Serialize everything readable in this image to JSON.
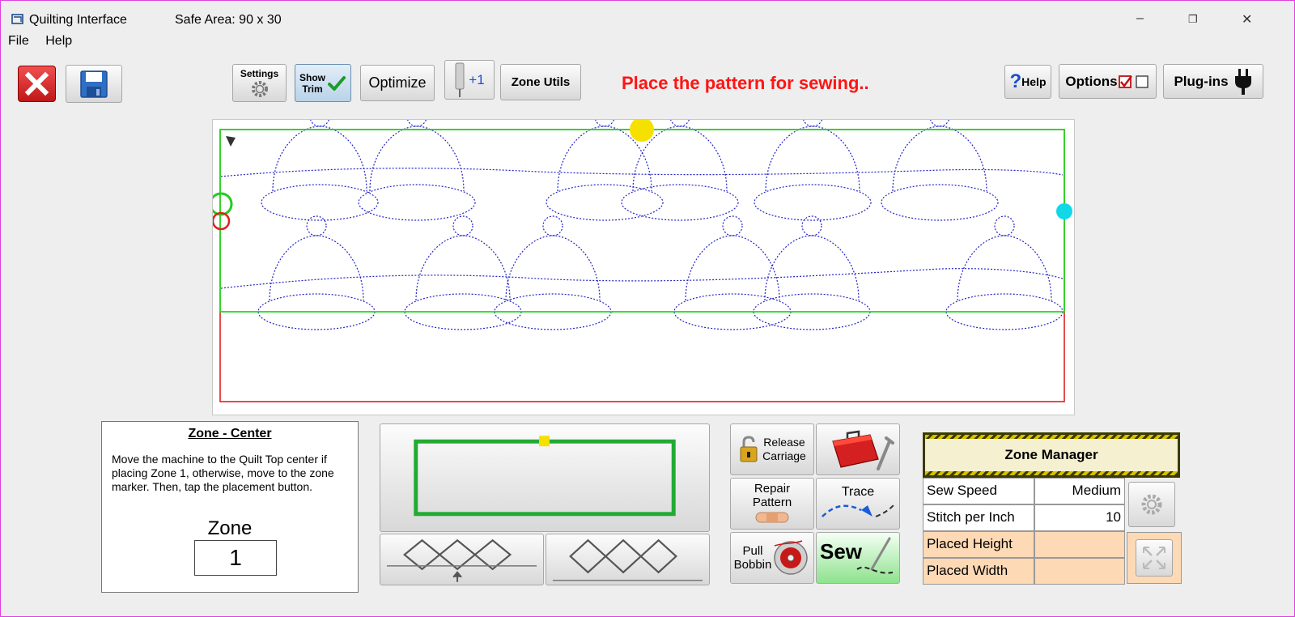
{
  "window": {
    "title": "Quilting Interface",
    "safe_area": "Safe Area:  90 x 30",
    "minimize": "–",
    "restore": "❐",
    "close": "✕"
  },
  "menu": {
    "file": "File",
    "help": "Help"
  },
  "toolbar": {
    "settings_label": "Settings",
    "show_trim_label_1": "Show",
    "show_trim_label_2": "Trim",
    "optimize_label": "Optimize",
    "needle_plus_label": "+1",
    "zone_utils_label": "Zone Utils",
    "status_message": "Place the pattern for sewing..",
    "help_label": "Help",
    "help_mark": "?",
    "options_label": "Options",
    "plugins_label": "Plug-ins"
  },
  "info_panel": {
    "title": "Zone - Center",
    "text": "Move the machine to the Quilt Top center if placing Zone 1, otherwise, move to the zone marker. Then, tap the placement button.",
    "zone_label": "Zone",
    "zone_value": "1"
  },
  "tools": {
    "release_carriage_1": "Release",
    "release_carriage_2": "Carriage",
    "repair_pattern_1": "Repair",
    "repair_pattern_2": "Pattern",
    "trace": "Trace",
    "pull_bobbin_1": "Pull",
    "pull_bobbin_2": "Bobbin",
    "sew": "Sew"
  },
  "zone_manager": {
    "title": "Zone Manager",
    "rows": [
      {
        "label": "Sew Speed",
        "value": "Medium"
      },
      {
        "label": "Stitch per Inch",
        "value": "10"
      },
      {
        "label": "Placed Height",
        "value": ""
      },
      {
        "label": "Placed Width",
        "value": ""
      }
    ]
  },
  "colors": {
    "status_red": "#ff1414",
    "pattern_blue": "#2323c8",
    "safe_green": "#22dd22",
    "quilt_red": "#e02020",
    "marker_yellow": "#f5e000",
    "marker_cyan": "#10d8e8",
    "cell_orange": "#fdd9b5"
  },
  "icons": [
    "app-icon",
    "close-icon",
    "save-icon",
    "gear-icon",
    "checkmark-icon",
    "needle-icon",
    "help-icon",
    "checkbox-icon",
    "plug-icon",
    "lock-icon",
    "toolbox-icon",
    "bandage-icon",
    "trace-arrow-icon",
    "bobbin-icon",
    "sew-needle-icon"
  ]
}
